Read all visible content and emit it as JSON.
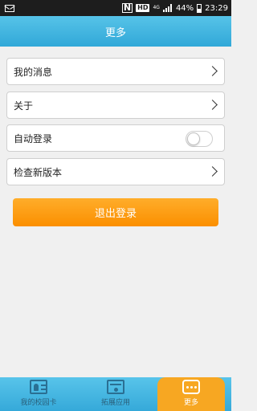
{
  "status_bar": {
    "network_label": "4G",
    "hd_label": "HD",
    "nfc_label": "N",
    "battery_text": "44%",
    "time": "23:29",
    "battery_level": 0.44
  },
  "header": {
    "title": "更多"
  },
  "menu": {
    "items": [
      {
        "label": "我的消息"
      },
      {
        "label": "关于"
      },
      {
        "label": "自动登录"
      },
      {
        "label": "检查新版本"
      }
    ],
    "auto_login_enabled": false
  },
  "logout_button": {
    "label": "退出登录"
  },
  "tabbar": {
    "tabs": [
      {
        "label": "我的校园卡"
      },
      {
        "label": "拓展应用"
      },
      {
        "label": "更多"
      }
    ],
    "active_index": 2
  },
  "colors": {
    "header": "#31a8d8",
    "logout": "#fb8f00",
    "active_tab": "#f7a722"
  },
  "icons": [
    "mail-icon",
    "nfc-icon",
    "signal-icon",
    "battery-icon",
    "chevron-right-icon",
    "card-icon",
    "box-icon",
    "more-icon"
  ]
}
